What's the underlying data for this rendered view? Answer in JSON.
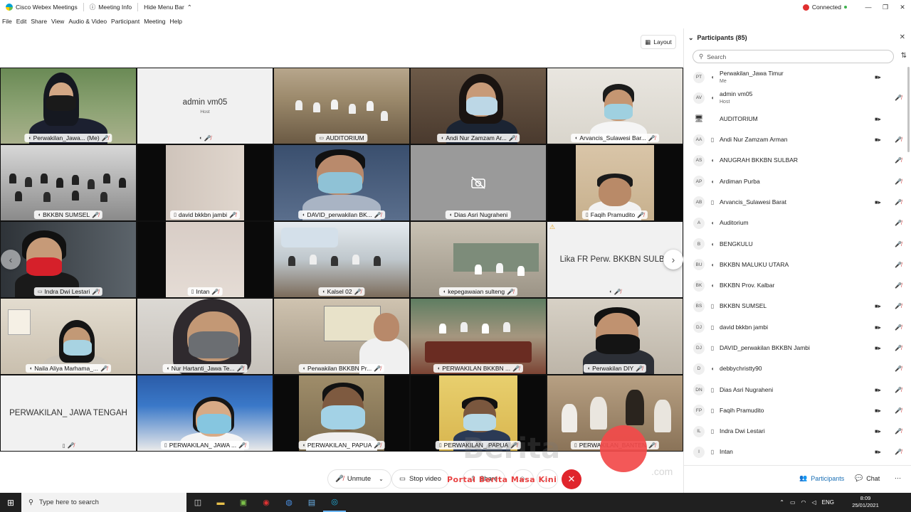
{
  "titlebar": {
    "app_title": "Cisco Webex Meetings",
    "meeting_info": "Meeting Info",
    "hide_menu": "Hide Menu Bar",
    "status": "Connected"
  },
  "menu": [
    "File",
    "Edit",
    "Share",
    "View",
    "Audio & Video",
    "Participant",
    "Meeting",
    "Help"
  ],
  "layout_label": "Layout",
  "tiles": [
    {
      "name": "Perwakilan_Jawa... (Me)",
      "kind": "video"
    },
    {
      "name": "admin vm05",
      "sub": "Host",
      "kind": "blank"
    },
    {
      "name": "AUDITORIUM",
      "kind": "video"
    },
    {
      "name": "Andi Nur Zamzam Ar...",
      "kind": "video"
    },
    {
      "name": "Arvancis_Sulawesi Bar...",
      "kind": "video"
    },
    {
      "name": "BKKBN SUMSEL",
      "kind": "video"
    },
    {
      "name": "david bkkbn jambi",
      "kind": "video"
    },
    {
      "name": "DAVID_perwakilan BK...",
      "kind": "video"
    },
    {
      "name": "Dias Asri Nugraheni",
      "kind": "camoff"
    },
    {
      "name": "Faqih Pramudito",
      "kind": "video"
    },
    {
      "name": "Indra Dwi Lestari",
      "kind": "video"
    },
    {
      "name": "Intan",
      "kind": "video"
    },
    {
      "name": "Kalsel 02",
      "kind": "video"
    },
    {
      "name": "kepegawaian sulteng",
      "kind": "video"
    },
    {
      "name": "Lika FR Perw. BKKBN SULBA",
      "kind": "blank"
    },
    {
      "name": "Naila Aliya Marhama_...",
      "kind": "video"
    },
    {
      "name": "Nur Hartanti_Jawa Te...",
      "kind": "video"
    },
    {
      "name": "Perwakilan BKKBN Pr...",
      "kind": "video"
    },
    {
      "name": "PERWAKILAN BKKBN ...",
      "kind": "video"
    },
    {
      "name": "Perwakilan DIY",
      "kind": "video"
    },
    {
      "name": "PERWAKILAN_ JAWA TENGAH",
      "kind": "blank"
    },
    {
      "name": "PERWAKILAN_ JAWA ...",
      "kind": "video"
    },
    {
      "name": "PERWAKILAN_ PAPUA",
      "kind": "video"
    },
    {
      "name": "PERWAKILAN_ PAPUA",
      "kind": "video"
    },
    {
      "name": "PERWAKILAN_BANTEN",
      "kind": "video"
    }
  ],
  "controls": {
    "unmute": "Unmute",
    "stop_video": "Stop video",
    "share": "Share"
  },
  "watermark": "Portal Berita Masa Kini",
  "watermark_brand": "Berita",
  "watermark_domain": ".com",
  "panel": {
    "title": "Participants (85)",
    "search_placeholder": "Search",
    "participants": [
      {
        "initials": "PT",
        "name": "Perwakilan_Jawa Timur",
        "role": "Me",
        "cam": true,
        "muted": false
      },
      {
        "initials": "AV",
        "name": "admin vm05",
        "role": "Host",
        "cam": false,
        "muted": true
      },
      {
        "initials": "",
        "name": "AUDITORIUM",
        "role": "",
        "cam": true,
        "muted": false
      },
      {
        "initials": "AA",
        "name": "Andi Nur Zamzam Arman",
        "role": "",
        "cam": true,
        "muted": true
      },
      {
        "initials": "AS",
        "name": "ANUGRAH BKKBN SULBAR",
        "role": "",
        "cam": false,
        "muted": true
      },
      {
        "initials": "AP",
        "name": "Ardiman Purba",
        "role": "",
        "cam": false,
        "muted": true
      },
      {
        "initials": "AB",
        "name": "Arvancis_Sulawesi Barat",
        "role": "",
        "cam": true,
        "muted": true
      },
      {
        "initials": "A",
        "name": "Auditorium",
        "role": "",
        "cam": false,
        "muted": true
      },
      {
        "initials": "B",
        "name": "BENGKULU",
        "role": "",
        "cam": false,
        "muted": true
      },
      {
        "initials": "BU",
        "name": "BKKBN MALUKU UTARA",
        "role": "",
        "cam": false,
        "muted": true
      },
      {
        "initials": "BK",
        "name": "BKKBN Prov. Kalbar",
        "role": "",
        "cam": false,
        "muted": true
      },
      {
        "initials": "BS",
        "name": "BKKBN SUMSEL",
        "role": "",
        "cam": true,
        "muted": true
      },
      {
        "initials": "DJ",
        "name": "david bkkbn jambi",
        "role": "",
        "cam": true,
        "muted": true
      },
      {
        "initials": "DJ",
        "name": "DAVID_perwakilan BKKBN Jambi",
        "role": "",
        "cam": true,
        "muted": true
      },
      {
        "initials": "D",
        "name": "debbychristty90",
        "role": "",
        "cam": false,
        "muted": true
      },
      {
        "initials": "DN",
        "name": "Dias Asri Nugraheni",
        "role": "",
        "cam": true,
        "muted": true
      },
      {
        "initials": "FP",
        "name": "Faqih Pramudito",
        "role": "",
        "cam": true,
        "muted": true
      },
      {
        "initials": "IL",
        "name": "Indra Dwi Lestari",
        "role": "",
        "cam": true,
        "muted": true
      },
      {
        "initials": "I",
        "name": "Intan",
        "role": "",
        "cam": true,
        "muted": true
      }
    ],
    "footer_participants": "Participants",
    "footer_chat": "Chat"
  },
  "taskbar": {
    "search_placeholder": "Type here to search",
    "lang": "ENG",
    "time": "8:09",
    "date": "25/01/2021"
  }
}
